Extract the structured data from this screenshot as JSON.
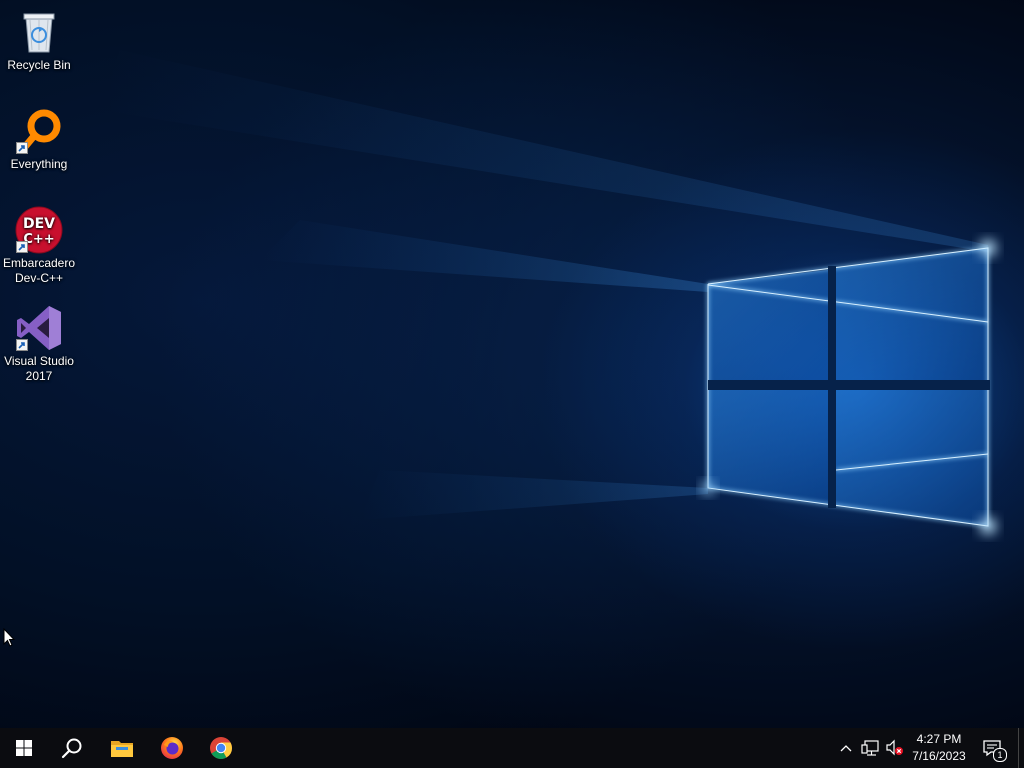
{
  "desktop": {
    "icons": [
      {
        "label": "Recycle Bin",
        "icon": "recycle-bin-icon"
      },
      {
        "label": "Everything",
        "icon": "everything-search-icon"
      },
      {
        "label": "Embarcadero Dev-C++",
        "icon": "dev-cpp-icon",
        "logo_text_1": "DEV",
        "logo_text_2": "C++"
      },
      {
        "label": "Visual Studio 2017",
        "icon": "visual-studio-icon"
      }
    ]
  },
  "taskbar": {
    "buttons": [
      {
        "name": "start-button",
        "icon": "windows-logo-icon"
      },
      {
        "name": "search-button",
        "icon": "search-icon"
      },
      {
        "name": "file-explorer-button",
        "icon": "folder-icon"
      },
      {
        "name": "firefox-button",
        "icon": "firefox-icon"
      },
      {
        "name": "chrome-button",
        "icon": "chrome-icon"
      }
    ],
    "tray": {
      "icons": [
        "chevron-up-icon",
        "network-icon",
        "volume-muted-icon"
      ],
      "time": "4:27 PM",
      "date": "7/16/2023",
      "notification_count": "1"
    }
  },
  "colors": {
    "taskbar": "#0b0c10",
    "wallpaper_dark": "#021026",
    "wallpaper_glow": "#1e7be0",
    "everything_orange": "#ff8a00",
    "devcpp_red": "#c8102e",
    "vs_purple": "#865fc5"
  }
}
